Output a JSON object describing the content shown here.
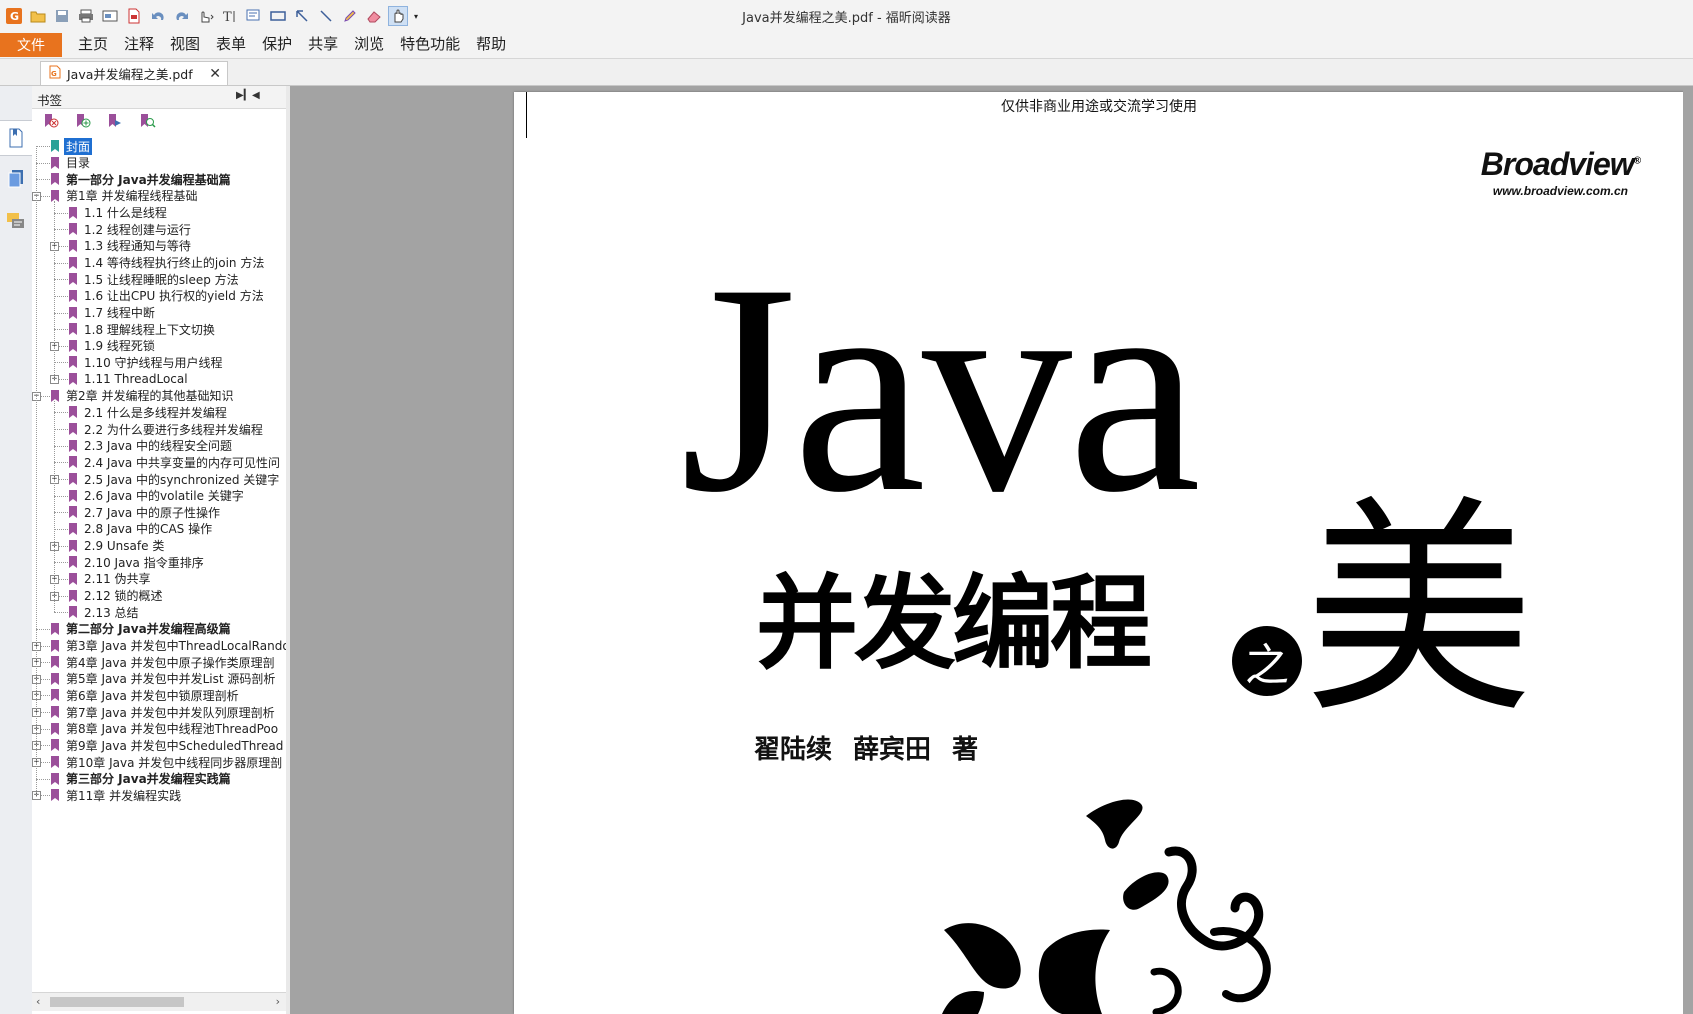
{
  "window": {
    "title": "Java并发编程之美.pdf - 福昕阅读器"
  },
  "ribbon": {
    "file_label": "文件",
    "tabs": [
      "主页",
      "注释",
      "视图",
      "表单",
      "保护",
      "共享",
      "浏览",
      "特色功能",
      "帮助"
    ]
  },
  "quick_access": [
    "app-logo-icon",
    "open-folder-icon",
    "save-icon",
    "print-icon",
    "scan-icon",
    "new-pdf-icon",
    "undo-icon",
    "redo-icon",
    "hand-select-icon",
    "text-select-icon",
    "typewriter-icon",
    "callout-icon",
    "rectangle-icon",
    "arrow-icon",
    "line-icon",
    "pencil-icon",
    "eraser-icon",
    "hand-tool-icon",
    "dropdown-icon"
  ],
  "document_tab": {
    "name": "Java并发编程之美.pdf"
  },
  "bookmarks_panel": {
    "title": "书签",
    "items": [
      {
        "label": "封面",
        "level": 0,
        "bold": false,
        "expander": "",
        "selected": true
      },
      {
        "label": "目录",
        "level": 0,
        "bold": false,
        "expander": ""
      },
      {
        "label": "第一部分 Java并发编程基础篇",
        "level": 0,
        "bold": true,
        "expander": ""
      },
      {
        "label": "第1章 并发编程线程基础",
        "level": 0,
        "bold": false,
        "expander": "-"
      },
      {
        "label": "1.1 什么是线程",
        "level": 1,
        "bold": false,
        "expander": ""
      },
      {
        "label": "1.2 线程创建与运行",
        "level": 1,
        "bold": false,
        "expander": ""
      },
      {
        "label": "1.3 线程通知与等待",
        "level": 1,
        "bold": false,
        "expander": "+"
      },
      {
        "label": "1.4 等待线程执行终止的join 方法",
        "level": 1,
        "bold": false,
        "expander": ""
      },
      {
        "label": "1.5 让线程睡眠的sleep 方法",
        "level": 1,
        "bold": false,
        "expander": ""
      },
      {
        "label": "1.6 让出CPU 执行权的yield 方法",
        "level": 1,
        "bold": false,
        "expander": ""
      },
      {
        "label": "1.7 线程中断",
        "level": 1,
        "bold": false,
        "expander": ""
      },
      {
        "label": "1.8 理解线程上下文切换",
        "level": 1,
        "bold": false,
        "expander": ""
      },
      {
        "label": "1.9 线程死锁",
        "level": 1,
        "bold": false,
        "expander": "+"
      },
      {
        "label": "1.10 守护线程与用户线程",
        "level": 1,
        "bold": false,
        "expander": ""
      },
      {
        "label": "1.11 ThreadLocal",
        "level": 1,
        "bold": false,
        "expander": "+"
      },
      {
        "label": "第2章 并发编程的其他基础知识",
        "level": 0,
        "bold": false,
        "expander": "-"
      },
      {
        "label": "2.1 什么是多线程并发编程",
        "level": 1,
        "bold": false,
        "expander": ""
      },
      {
        "label": "2.2 为什么要进行多线程并发编程",
        "level": 1,
        "bold": false,
        "expander": ""
      },
      {
        "label": "2.3 Java 中的线程安全问题",
        "level": 1,
        "bold": false,
        "expander": ""
      },
      {
        "label": "2.4 Java 中共享变量的内存可见性问",
        "level": 1,
        "bold": false,
        "expander": ""
      },
      {
        "label": "2.5 Java 中的synchronized 关键字",
        "level": 1,
        "bold": false,
        "expander": "+"
      },
      {
        "label": "2.6 Java 中的volatile 关键字",
        "level": 1,
        "bold": false,
        "expander": ""
      },
      {
        "label": "2.7 Java 中的原子性操作",
        "level": 1,
        "bold": false,
        "expander": ""
      },
      {
        "label": "2.8 Java 中的CAS 操作",
        "level": 1,
        "bold": false,
        "expander": ""
      },
      {
        "label": "2.9 Unsafe 类",
        "level": 1,
        "bold": false,
        "expander": "+"
      },
      {
        "label": "2.10 Java 指令重排序",
        "level": 1,
        "bold": false,
        "expander": ""
      },
      {
        "label": "2.11 伪共享",
        "level": 1,
        "bold": false,
        "expander": "+"
      },
      {
        "label": "2.12 锁的概述",
        "level": 1,
        "bold": false,
        "expander": "+"
      },
      {
        "label": "2.13 总结",
        "level": 1,
        "bold": false,
        "expander": ""
      },
      {
        "label": "第二部分 Java并发编程高级篇",
        "level": 0,
        "bold": true,
        "expander": ""
      },
      {
        "label": "第3章 Java 并发包中ThreadLocalRando",
        "level": 0,
        "bold": false,
        "expander": "+"
      },
      {
        "label": "第4章 Java 并发包中原子操作类原理剖",
        "level": 0,
        "bold": false,
        "expander": "+"
      },
      {
        "label": "第5章 Java 并发包中并发List 源码剖析",
        "level": 0,
        "bold": false,
        "expander": "+"
      },
      {
        "label": "第6章 Java 并发包中锁原理剖析",
        "level": 0,
        "bold": false,
        "expander": "+"
      },
      {
        "label": "第7章 Java 并发包中并发队列原理剖析",
        "level": 0,
        "bold": false,
        "expander": "+"
      },
      {
        "label": "第8章 Java 并发包中线程池ThreadPoo",
        "level": 0,
        "bold": false,
        "expander": "+"
      },
      {
        "label": "第9章 Java 并发包中ScheduledThread",
        "level": 0,
        "bold": false,
        "expander": "+"
      },
      {
        "label": "第10章 Java 并发包中线程同步器原理剖",
        "level": 0,
        "bold": false,
        "expander": "+"
      },
      {
        "label": "第三部分 Java并发编程实践篇",
        "level": 0,
        "bold": true,
        "expander": ""
      },
      {
        "label": "第11章 并发编程实践",
        "level": 0,
        "bold": false,
        "expander": "+"
      }
    ]
  },
  "page": {
    "watermark": "仅供非商业用途或交流学习使用",
    "publisher": "Broadview",
    "publisher_mark": "®",
    "publisher_url": "www.broadview.com.cn",
    "title_latin": "Java",
    "title_cn": "并发编程",
    "title_zhi": "之",
    "title_mei": "美",
    "authors": "翟陆续 薛宾田 著"
  },
  "colors": {
    "file_tab": "#e8731e",
    "selection": "#1f6fd1",
    "bookmark": "#9b4f9a",
    "bookmark_sel": "#2aa198",
    "viewport_bg": "#a3a3a3"
  }
}
